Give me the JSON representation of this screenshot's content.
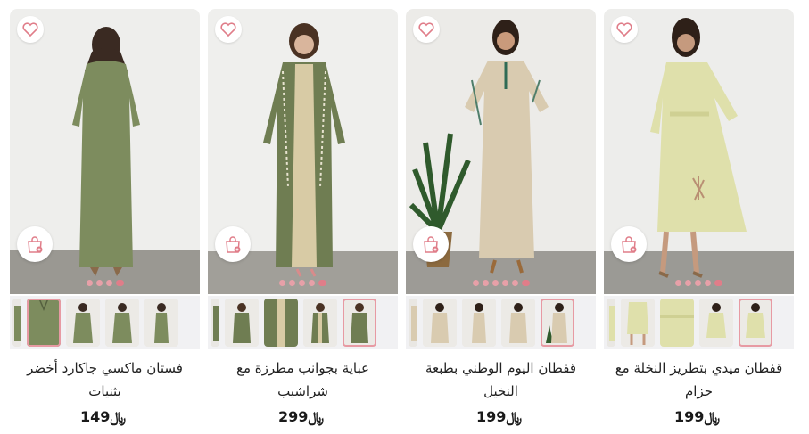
{
  "colors": {
    "accent_pink": "#e07d89",
    "olive_green": "#7d8c5e",
    "beige": "#d9cbb0",
    "pistachio": "#dfe0ab"
  },
  "icons": {
    "wishlist": "heart-outline-icon",
    "add_to_bag": "shopping-bag-plus-icon"
  },
  "products": [
    {
      "title": "قفطان ميدي بتطريز النخلة مع حزام",
      "price": "199",
      "currency": "﷼",
      "image_dots": 5,
      "active_dot": 4
    },
    {
      "title": "قفطان اليوم الوطني بطبعة النخيل",
      "price": "199",
      "currency": "﷼",
      "image_dots": 6,
      "active_dot": 5
    },
    {
      "title": "عباية بجوانب مطرزة مع شراشيب",
      "price": "299",
      "currency": "﷼",
      "image_dots": 5,
      "active_dot": 4
    },
    {
      "title": "فستان ماكسي جاكارد أخضر بثنيات",
      "price": "149",
      "currency": "﷼",
      "image_dots": 4,
      "active_dot": 3
    }
  ]
}
